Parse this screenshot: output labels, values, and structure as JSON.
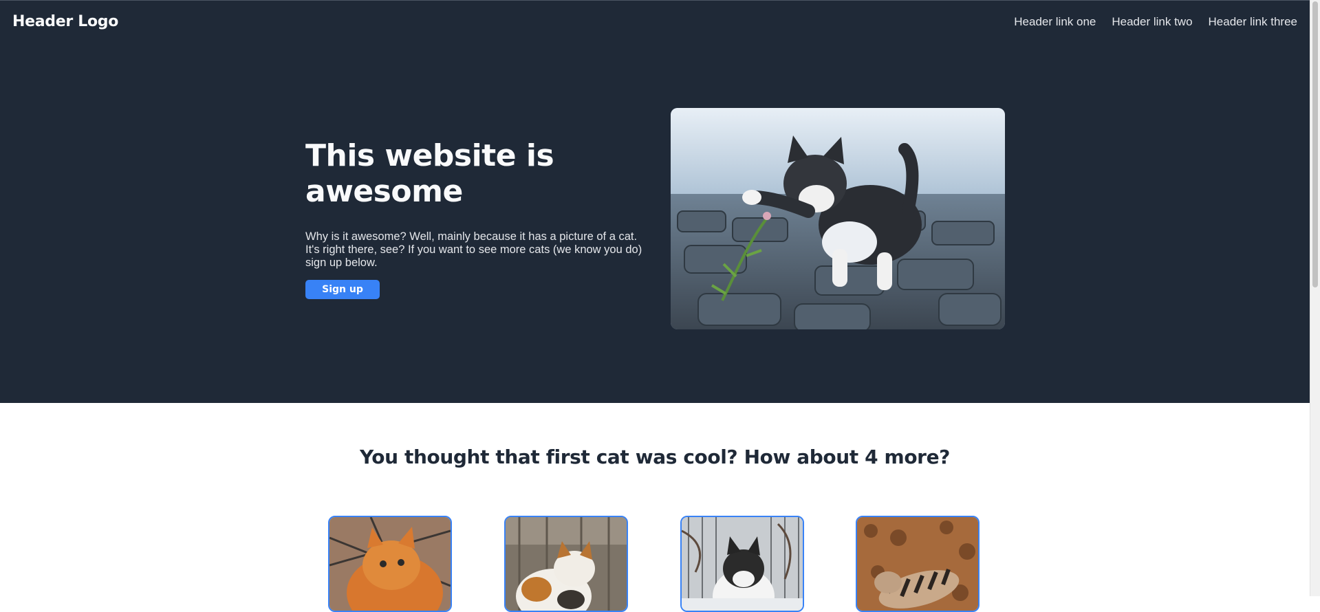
{
  "header": {
    "logo": "Header Logo",
    "links": [
      "Header link one",
      "Header link two",
      "Header link three"
    ]
  },
  "hero": {
    "title": "This website is awesome",
    "description": "Why is it awesome? Well, mainly because it has a picture of a cat. It's right there, see? If you want to see more cats (we know you do) sign up below.",
    "button_label": "Sign up",
    "image": "kitten-playing-with-flower"
  },
  "cats_section": {
    "title": "You thought that first cat was cool? How about 4 more?",
    "images": [
      "orange-cat",
      "calico-cat",
      "fluffy-black-white-cat",
      "tabby-cat-in-leaves"
    ]
  },
  "colors": {
    "header_bg": "#1f2937",
    "accent": "#3882f6",
    "text_dark": "#1f2937"
  }
}
